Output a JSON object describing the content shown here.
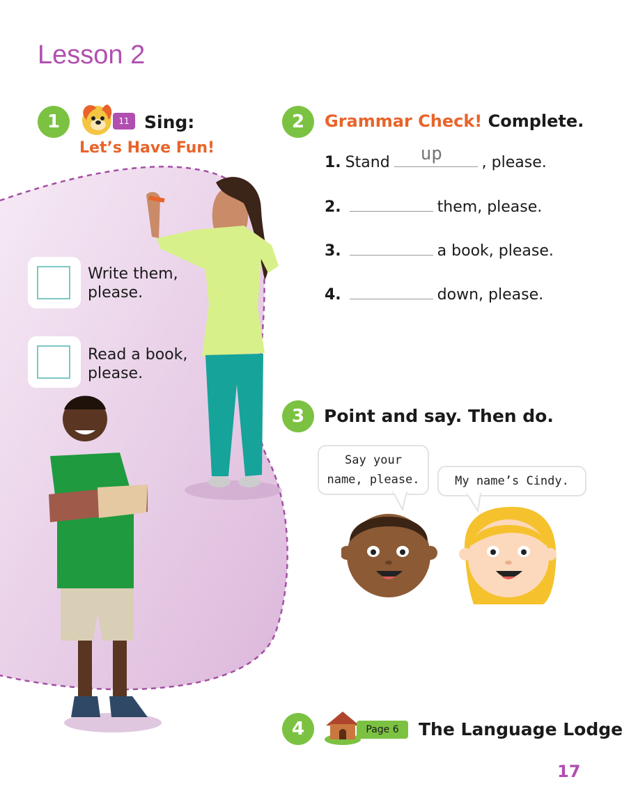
{
  "lesson_title": "Lesson 2",
  "activity1": {
    "number": "1",
    "track": "11",
    "instruction": "Sing:",
    "song_title": "Let’s Have Fun!",
    "choices": [
      {
        "text_line1": "Write them,",
        "text_line2": "please."
      },
      {
        "text_line1": "Read a book,",
        "text_line2": "please."
      }
    ]
  },
  "activity2": {
    "number": "2",
    "heading_accent": "Grammar Check!",
    "heading_rest": "Complete.",
    "items": [
      {
        "num": "1.",
        "before": "Stand",
        "answer": "up",
        "after": ", please."
      },
      {
        "num": "2.",
        "before": "",
        "answer": "",
        "after": "them, please."
      },
      {
        "num": "3.",
        "before": "",
        "answer": "",
        "after": "a book, please."
      },
      {
        "num": "4.",
        "before": "",
        "answer": "",
        "after": "down, please."
      }
    ]
  },
  "activity3": {
    "number": "3",
    "instruction": "Point and say. Then do.",
    "bubble1_line1": "Say your",
    "bubble1_line2": "name, please.",
    "bubble2": "My name’s Cindy."
  },
  "activity4": {
    "number": "4",
    "page_ref": "Page 6",
    "title": "The Language Lodge"
  },
  "page_number": "17",
  "colors": {
    "accent_purple": "#b04fb0",
    "accent_orange": "#e8642a",
    "accent_green": "#7cc242"
  }
}
